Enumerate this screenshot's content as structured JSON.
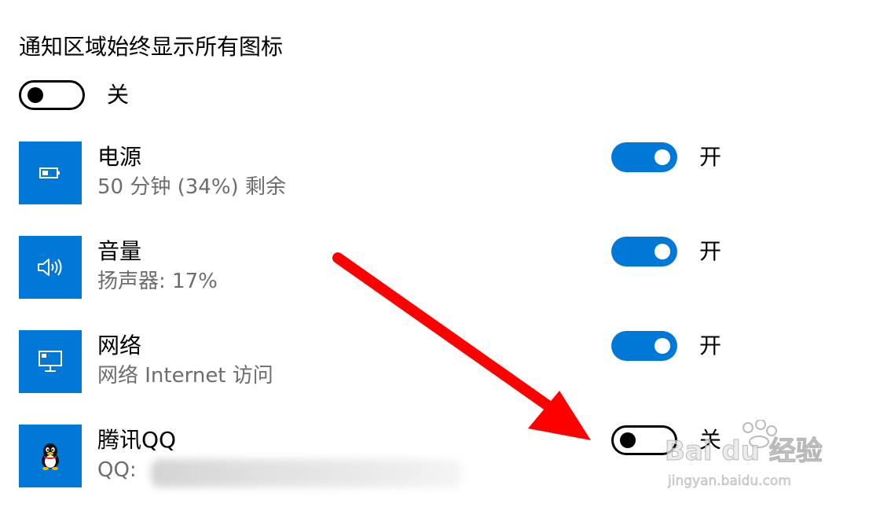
{
  "section_title": "通知区域始终显示所有图标",
  "master_toggle": {
    "state_label": "关",
    "on": false
  },
  "apps": [
    {
      "name": "电源",
      "description": "50 分钟 (34%) 剩余",
      "icon": "battery-icon",
      "toggle_on": true,
      "toggle_label": "开"
    },
    {
      "name": "音量",
      "description": "扬声器: 17%",
      "icon": "speaker-icon",
      "toggle_on": true,
      "toggle_label": "开"
    },
    {
      "name": "网络",
      "description": "网络 Internet 访问",
      "icon": "network-icon",
      "toggle_on": true,
      "toggle_label": "开"
    },
    {
      "name": "腾讯QQ",
      "description": "QQ: ",
      "icon": "qq-penguin-icon",
      "toggle_on": false,
      "toggle_label": "关"
    }
  ],
  "watermark": {
    "brand": "Bai du 经验",
    "url": "jingyan.baidu.com"
  },
  "colors": {
    "accent": "#0078d7",
    "toggle_off_border": "#000000",
    "secondary_text": "#6d6d6d",
    "annotation_arrow": "#ff0000"
  }
}
